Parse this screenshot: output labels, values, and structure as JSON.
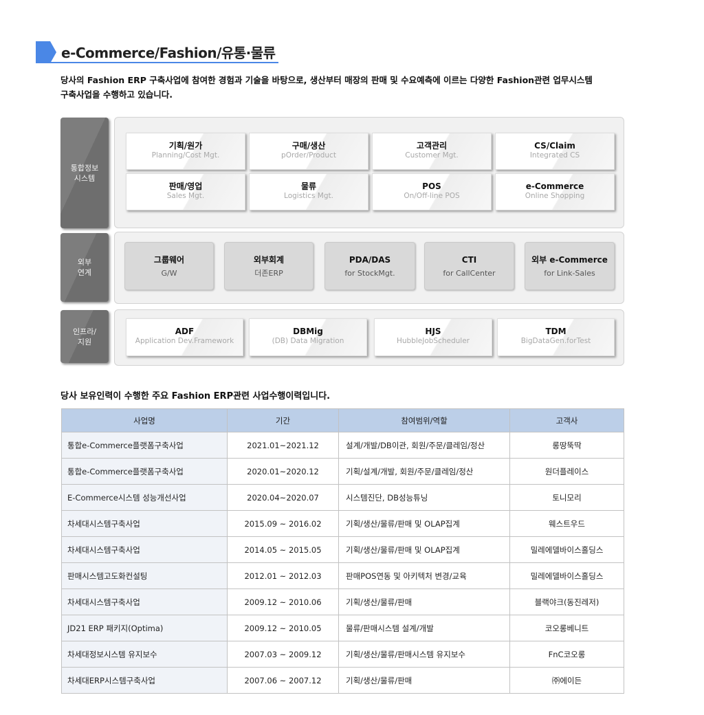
{
  "header": {
    "title": "e-Commerce/Fashion/유통·물류",
    "intro_line1": "당사의 Fashion ERP 구축사업에 참여한 경험과 기술을 바탕으로, 생산부터 매장의 판매 및 수요예측에 이르는 다양한 Fashion관련 업무시스템",
    "intro_line2": "구축사업을 수행하고 있습니다."
  },
  "diagram": {
    "integrated": {
      "label": "통합정보\n시스템",
      "row1": [
        {
          "title": "기획/원가",
          "sub": "Planning/Cost Mgt."
        },
        {
          "title": "구매/생산",
          "sub": "pOrder/Product"
        },
        {
          "title": "고객관리",
          "sub": "Customer Mgt."
        },
        {
          "title": "CS/Claim",
          "sub": "Integrated CS"
        }
      ],
      "row2": [
        {
          "title": "판매/영업",
          "sub": "Sales Mgt."
        },
        {
          "title": "물류",
          "sub": "Logistics Mgt."
        },
        {
          "title": "POS",
          "sub": "On/Off-line POS"
        },
        {
          "title": "e-Commerce",
          "sub": "Online Shopping"
        }
      ]
    },
    "external": {
      "label": "외부\n연계",
      "items": [
        {
          "title": "그룹웨어",
          "sub": "G/W"
        },
        {
          "title": "외부회계",
          "sub": "더존ERP"
        },
        {
          "title": "PDA/DAS",
          "sub": "for StockMgt."
        },
        {
          "title": "CTI",
          "sub": "for CallCenter"
        },
        {
          "title": "외부 e-Commerce",
          "sub": "for Link-Sales"
        }
      ]
    },
    "infra": {
      "label": "인프라/\n지원",
      "items": [
        {
          "title": "ADF",
          "sub": "Application Dev.Framework"
        },
        {
          "title": "DBMig",
          "sub": "(DB) Data Migration"
        },
        {
          "title": "HJS",
          "sub": "HubbleJobScheduler"
        },
        {
          "title": "TDM",
          "sub": "BigDataGen.forTest"
        }
      ]
    }
  },
  "history": {
    "title": "당사 보유인력이 수행한 주요 Fashion ERP관련 사업수행이력입니다.",
    "columns": [
      "사업명",
      "기간",
      "참여범위/역할",
      "고객사"
    ],
    "rows": [
      [
        "통합e-Commerce플랫폼구축사업",
        "2021.01~2021.12",
        "설계/개발/DB이관,  회원/주문/클레임/정산",
        "롱땅뚝딱"
      ],
      [
        "통합e-Commerce플랫폼구축사업",
        "2020.01~2020.12",
        "기획/설계/개발,  회원/주문/클레임/정산",
        "원더플레이스"
      ],
      [
        "E-Commerce시스템 성능개선사업",
        "2020.04~2020.07",
        "시스템진단,  DB성능튜닝",
        "토니모리"
      ],
      [
        "차세대시스템구축사업",
        "2015.09 ~ 2016.02",
        "기획/생산/물류/판매  및 OLAP집계",
        "웨스트우드"
      ],
      [
        "차세대시스템구축사업",
        "2014.05 ~ 2015.05",
        "기획/생산/물류/판매  및 OLAP집계",
        "밀레에델바이스홀딩스"
      ],
      [
        "판매시스템고도화컨설팅",
        "2012.01 ~ 2012.03",
        "판매POS연동 및 아키텍처 변경/교육",
        "밀레에델바이스홀딩스"
      ],
      [
        "차세대시스템구축사업",
        "2009.12 ~ 2010.06",
        "기획/생산/물류/판매",
        "블랙야크(동진레저)"
      ],
      [
        "JD21 ERP 패키지(Optima)",
        "2009.12 ~ 2010.05",
        "물류/판매시스템  설계/개발",
        "코오롱베니트"
      ],
      [
        "차세대정보시스템  유지보수",
        "2007.03 ~ 2009.12",
        "기획/생산/물류/판매시스템   유지보수",
        "FnC코오롱"
      ],
      [
        "차세대ERP시스템구축사업",
        "2007.06 ~ 2007.12",
        "기획/생산/물류/판매",
        "㈜에이든"
      ]
    ]
  }
}
